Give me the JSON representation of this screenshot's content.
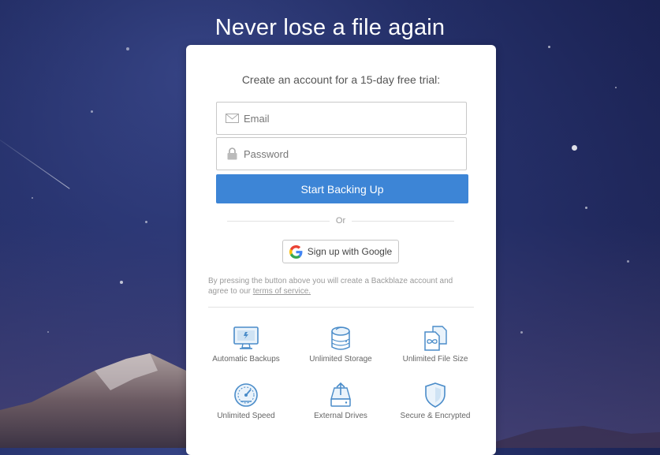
{
  "headline": "Never lose a file again",
  "signup": {
    "intro": "Create an account for a 15-day free trial:",
    "email_placeholder": "Email",
    "password_placeholder": "Password",
    "submit_label": "Start Backing Up",
    "or_text": "Or",
    "google_label": "Sign up with Google",
    "legal_text": "By pressing the button above you will create a Backblaze account and agree to our ",
    "legal_link": "terms of service."
  },
  "features": [
    {
      "label": "Automatic Backups",
      "icon": "monitor-icon"
    },
    {
      "label": "Unlimited Storage",
      "icon": "hard-drive-icon"
    },
    {
      "label": "Unlimited File Size",
      "icon": "file-infinity-icon"
    },
    {
      "label": "Unlimited Speed",
      "icon": "speedometer-icon"
    },
    {
      "label": "External Drives",
      "icon": "external-drive-icon"
    },
    {
      "label": "Secure & Encrypted",
      "icon": "shield-icon"
    }
  ],
  "colors": {
    "accent": "#3d85d6",
    "icon_blue": "#4a8cc9",
    "google_blue": "#4285F4",
    "google_red": "#EA4335",
    "google_yellow": "#FBBC05",
    "google_green": "#34A853"
  }
}
